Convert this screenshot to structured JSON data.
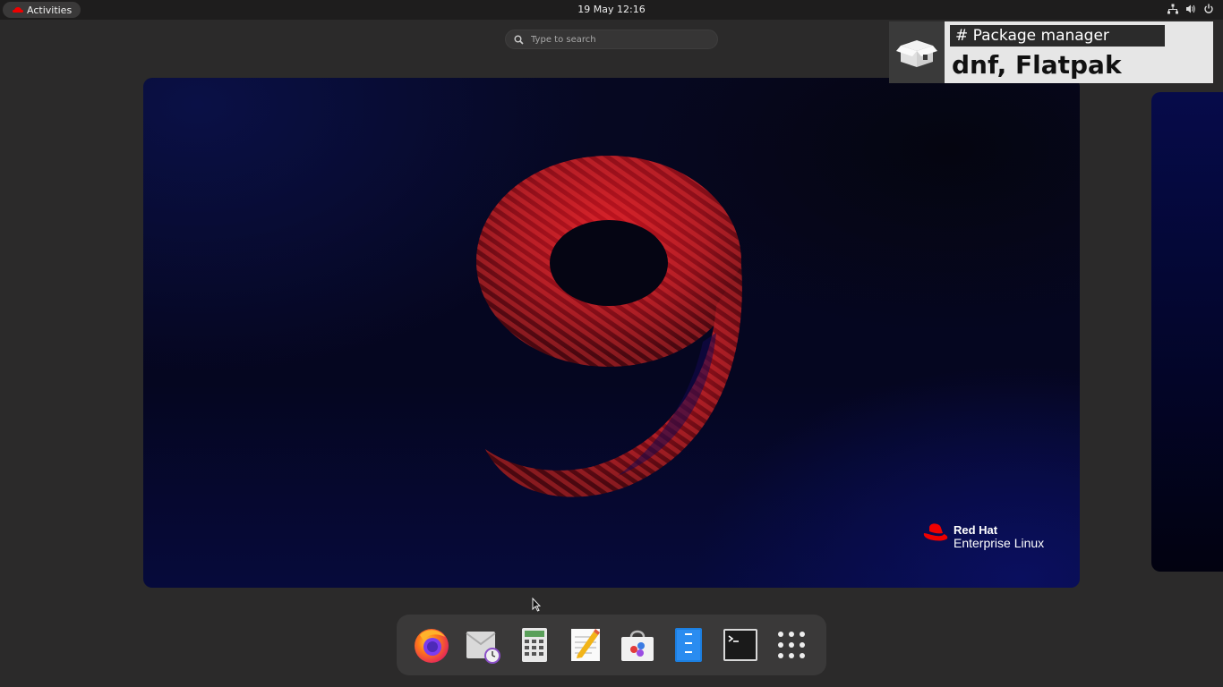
{
  "topbar": {
    "activities_label": "Activities",
    "clock": "19 May  12:16",
    "tray": [
      "network-icon",
      "volume-icon",
      "power-icon"
    ]
  },
  "search": {
    "placeholder": "Type to search"
  },
  "wallpaper": {
    "brand_name": "Red Hat",
    "brand_product": "Enterprise Linux"
  },
  "banner": {
    "tag": "# Package manager",
    "title": "dnf, Flatpak"
  },
  "dock": {
    "items": [
      {
        "name": "firefox-icon"
      },
      {
        "name": "mail-clock-icon"
      },
      {
        "name": "calculator-icon"
      },
      {
        "name": "text-editor-icon"
      },
      {
        "name": "software-store-icon"
      },
      {
        "name": "file-archive-icon"
      },
      {
        "name": "terminal-icon"
      },
      {
        "name": "app-grid-icon"
      }
    ]
  },
  "colors": {
    "accent_red": "#ee0000",
    "panel": "#1e1d1d",
    "background": "#2b2a2a"
  }
}
